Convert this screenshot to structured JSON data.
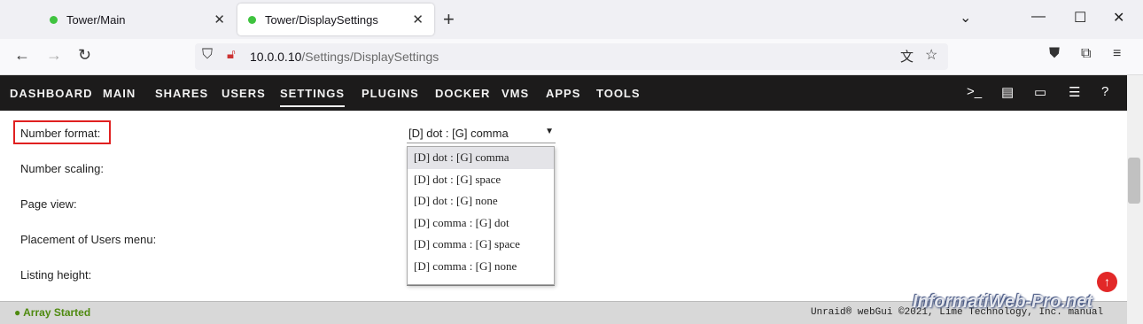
{
  "browser": {
    "tabs": [
      {
        "title": "Tower/Main",
        "active": false
      },
      {
        "title": "Tower/DisplaySettings",
        "active": true
      }
    ],
    "url_host": "10.0.0.10",
    "url_path": "/Settings/DisplaySettings"
  },
  "menu": {
    "items": [
      "DASHBOARD",
      "MAIN",
      "SHARES",
      "USERS",
      "SETTINGS",
      "PLUGINS",
      "DOCKER",
      "VMS",
      "APPS",
      "TOOLS"
    ],
    "active": "SETTINGS"
  },
  "settings": {
    "labels": [
      "Number format:",
      "Number scaling:",
      "Page view:",
      "Placement of Users menu:",
      "Listing height:"
    ],
    "number_format_value": "[D] dot : [G] comma",
    "number_format_options": [
      "[D] dot : [G] comma",
      "[D] dot : [G] space",
      "[D] dot : [G] none",
      "[D] comma : [G] dot",
      "[D] comma : [G] space",
      "[D] comma : [G] none"
    ]
  },
  "footer": {
    "status": "Array Started",
    "copyright": "Unraid® webGui ©2021, Lime Technology, Inc. manual"
  },
  "watermark": "InformatiWeb-Pro.net",
  "colors": {
    "accent": "#e02020",
    "status_ok": "#4f8a10",
    "menubar": "#1c1b1b"
  }
}
